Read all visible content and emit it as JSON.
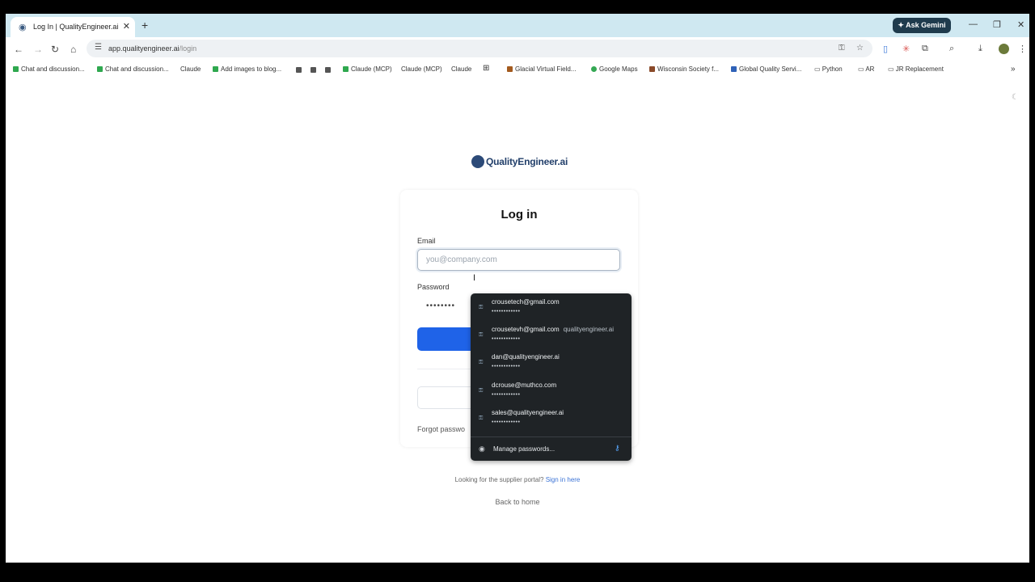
{
  "tab": {
    "title": "Log In | QualityEngineer.ai",
    "close": "✕",
    "new": "+"
  },
  "gemini": {
    "label": "Ask Gemini"
  },
  "window_controls": {
    "minimize": "—",
    "restore": "❐",
    "close": "✕"
  },
  "toolbar": {
    "url_host": "app.qualityengineer.ai",
    "url_path": "/login"
  },
  "bookmarks": [
    {
      "label": "Chat and discussion...",
      "color": "#2fa84f"
    },
    {
      "label": "Chat and discussion...",
      "color": "#2fa84f"
    },
    {
      "label": "Claude",
      "color": "#d98a5e"
    },
    {
      "label": "Add images to blog...",
      "color": "#2fa84f"
    },
    {
      "label": "Claude (MCP)",
      "color": "#2fa84f"
    },
    {
      "label": "Claude (MCP)",
      "color": "#d98a5e"
    },
    {
      "label": "Claude",
      "color": "#d98a5e"
    },
    {
      "label": "Glacial Virtual Field...",
      "color": "#a35a1e"
    },
    {
      "label": "Google Maps",
      "color": "#34a853"
    },
    {
      "label": "Wisconsin Society f...",
      "color": "#8a4a2a"
    },
    {
      "label": "Global Quality Servi...",
      "color": "#2f62b8"
    },
    {
      "label": "Python",
      "color": "#666666"
    },
    {
      "label": "AR",
      "color": "#666666"
    },
    {
      "label": "JR Replacement",
      "color": "#666666"
    }
  ],
  "logo": {
    "text": "QualityEngineer.ai"
  },
  "login": {
    "title": "Log in",
    "email_label": "Email",
    "email_placeholder": "you@company.com",
    "password_label": "Password",
    "password_masked": "••••••••",
    "forgot": "Forgot passwo"
  },
  "supplier": {
    "text": "Looking for the supplier portal? ",
    "link": "Sign in here"
  },
  "back_home": "Back to home",
  "autofill": {
    "items": [
      {
        "user": "crousetech@gmail.com",
        "site": "",
        "password": "••••••••••••"
      },
      {
        "user": "crousetevh@gmail.com",
        "site": "qualityengineer.ai",
        "password": "••••••••••••"
      },
      {
        "user": "dan@qualityengineer.ai",
        "site": "",
        "password": "••••••••••••"
      },
      {
        "user": "dcrouse@muthco.com",
        "site": "",
        "password": "••••••••••••"
      },
      {
        "user": "sales@qualityengineer.ai",
        "site": "",
        "password": "••••••••••••"
      }
    ],
    "manage": "Manage passwords..."
  }
}
